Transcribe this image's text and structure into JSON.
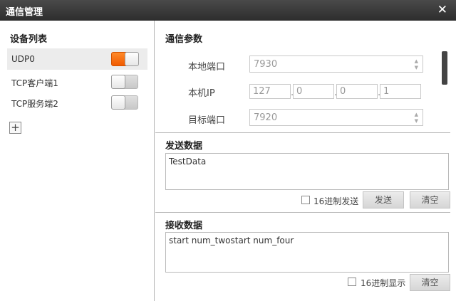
{
  "window": {
    "title": "通信管理",
    "close_glyph": "✕"
  },
  "device_list": {
    "heading": "设备列表",
    "items": [
      {
        "label": "UDP0",
        "enabled": true
      },
      {
        "label": "TCP客户端1",
        "enabled": false
      },
      {
        "label": "TCP服务端2",
        "enabled": false
      }
    ],
    "add_glyph": "+"
  },
  "params": {
    "heading": "通信参数",
    "local_port_label": "本地端口",
    "local_port_value": "7930",
    "local_ip_label": "本机IP",
    "ip_octets": [
      "127",
      "0",
      "0",
      "1"
    ],
    "target_port_label": "目标端口",
    "target_port_value": "7920"
  },
  "send": {
    "heading": "发送数据",
    "text": "TestData",
    "hex_label": "16进制发送",
    "hex_checked": false,
    "send_button": "发送",
    "clear_button": "清空"
  },
  "receive": {
    "heading": "接收数据",
    "text": "start num_twostart num_four",
    "hex_label": "16进制显示",
    "hex_checked": false,
    "clear_button": "清空"
  },
  "colors": {
    "accent": "#f26a10",
    "titlebar": "#333333"
  },
  "icons": {
    "close": "close-icon",
    "add": "plus-icon",
    "spin_up": "triangle-up-icon",
    "spin_down": "triangle-down-icon"
  }
}
